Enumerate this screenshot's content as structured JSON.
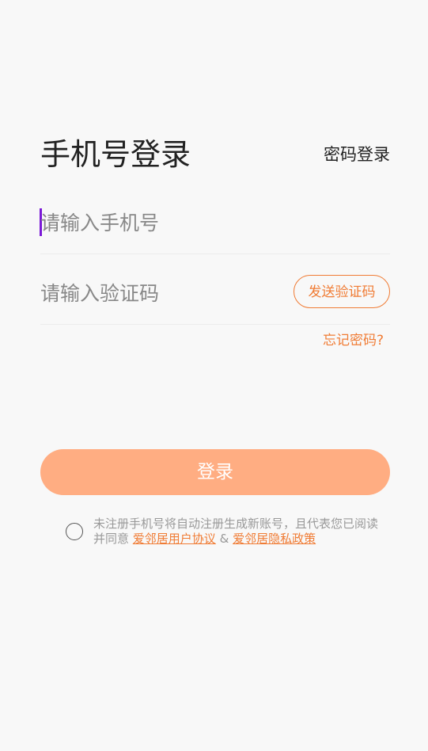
{
  "header": {
    "title": "手机号登录",
    "switch_label": "密码登录"
  },
  "phone_field": {
    "placeholder": "请输入手机号",
    "value": ""
  },
  "code_field": {
    "placeholder": "请输入验证码",
    "value": "",
    "send_label": "发送验证码"
  },
  "forgot_label": "忘记密码?",
  "login_label": "登录",
  "agreement": {
    "text": "未注册手机号将自动注册生成新账号，且代表您已阅读并同意",
    "link1": "爱邻居用户协议",
    "separator": "&",
    "link2": "爱邻居隐私政策",
    "checked": false
  },
  "colors": {
    "accent": "#f07c35",
    "button_bg": "#ffad82",
    "background": "#f8f8f8",
    "caret": "#7a19d6"
  }
}
